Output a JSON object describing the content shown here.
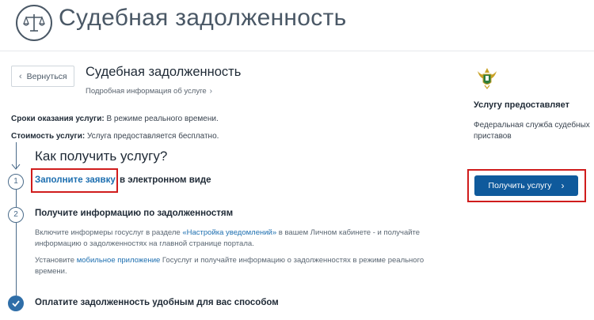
{
  "header": {
    "title": "Судебная задолженность",
    "logo_icon": "scales-icon"
  },
  "nav": {
    "back_label": "Вернуться",
    "back_icon": "chevron-left-icon"
  },
  "service": {
    "title": "Судебная задолженность",
    "details_link": "Подробная информация об услуге",
    "terms_label": "Сроки оказания услуги:",
    "terms_value": "В режиме реального времени.",
    "cost_label": "Стоимость услуги:",
    "cost_value": "Услуга предоставляется бесплатно."
  },
  "how": {
    "title": "Как получить услугу?",
    "step1": {
      "num": "1",
      "link": "Заполните заявку",
      "rest": "в электронном виде"
    },
    "step2": {
      "num": "2",
      "title": "Получите информацию по задолженностям",
      "p1_a": "Включите информеры госуслуг в разделе ",
      "p1_link": "«Настройка уведомлений»",
      "p1_b": " в вашем Личном кабинете - и получайте",
      "p1_c": "информацию о задолженностях на главной странице портала.",
      "p2_a": "Установите ",
      "p2_link": "мобильное приложение",
      "p2_b": " Госуслуг и получайте информацию о задолженностях в режиме реального",
      "p2_c": "времени."
    },
    "step3": {
      "title": "Оплатите задолженность удобным для вас способом"
    }
  },
  "provider": {
    "label": "Услугу предоставляет",
    "name": "Федеральная служба судебных приставов",
    "emblem_icon": "fssp-emblem-icon"
  },
  "actions": {
    "get_service_label": "Получить услугу",
    "get_service_icon": "chevron-right-icon"
  },
  "colors": {
    "brand_blue": "#0f5a9c",
    "link_blue": "#1d6fb0",
    "highlight_red": "#d01c1c"
  }
}
